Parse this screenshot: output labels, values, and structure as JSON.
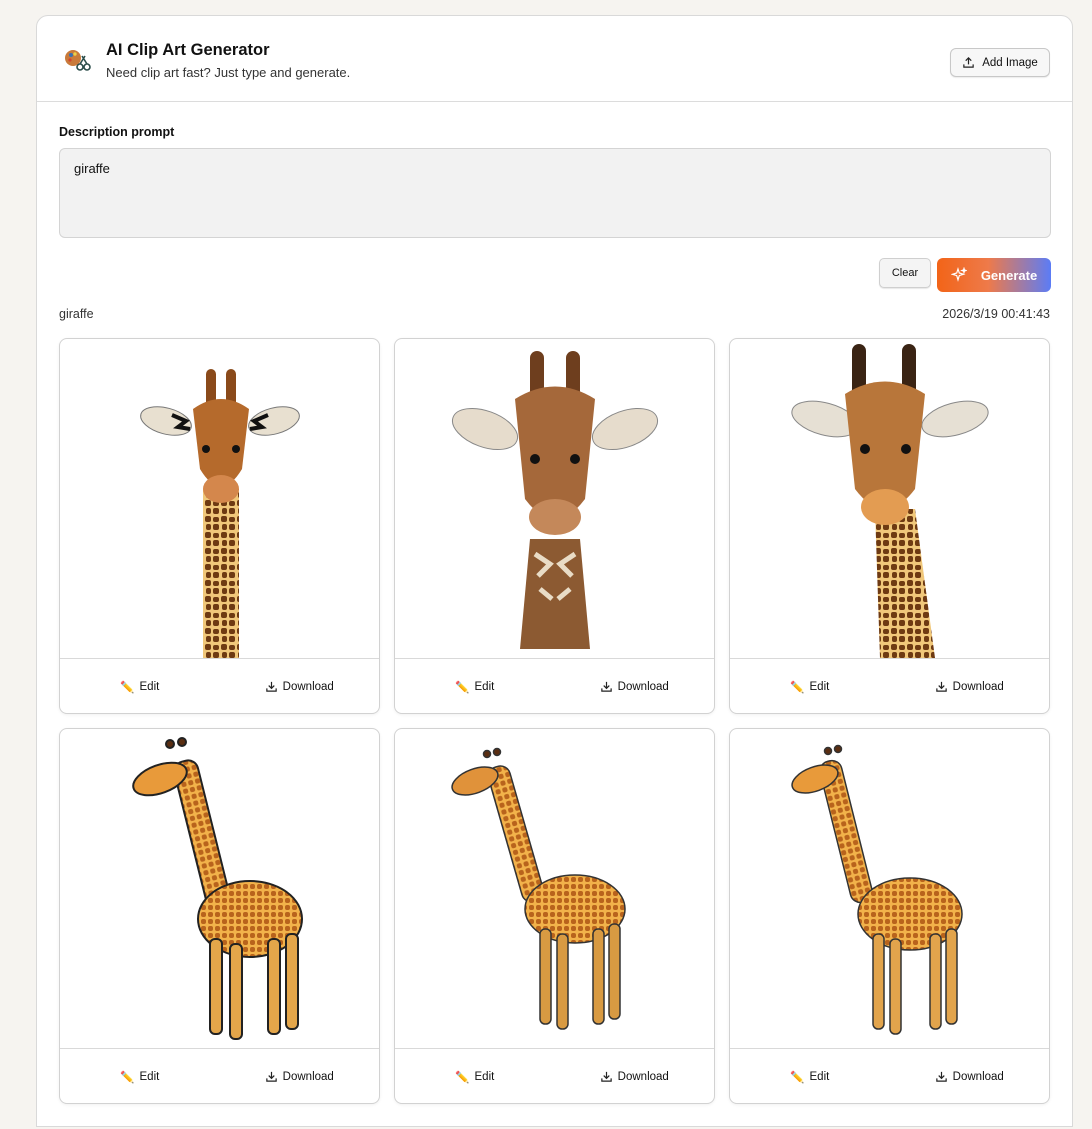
{
  "app": {
    "title": "AI Clip Art Generator",
    "subtitle": "Need clip art fast? Just type and generate.",
    "add_image_label": "Add Image"
  },
  "prompt": {
    "label": "Description prompt",
    "value": "giraffe"
  },
  "actions": {
    "clear_label": "Clear",
    "generate_label": "Generate"
  },
  "result": {
    "prompt": "giraffe",
    "timestamp": "2026/3/19 00:41:43"
  },
  "cards": [
    {
      "style": "head-stylized",
      "edit_label": "Edit",
      "download_label": "Download"
    },
    {
      "style": "head-realistic",
      "edit_label": "Edit",
      "download_label": "Download"
    },
    {
      "style": "head-detailed",
      "edit_label": "Edit",
      "download_label": "Download"
    },
    {
      "style": "full-cartoon",
      "edit_label": "Edit",
      "download_label": "Download"
    },
    {
      "style": "full-cartoon",
      "edit_label": "Edit",
      "download_label": "Download"
    },
    {
      "style": "full-cartoon",
      "edit_label": "Edit",
      "download_label": "Download"
    }
  ],
  "colors": {
    "accent_orange": "#f26418",
    "accent_blue": "#5b7cf6",
    "giraffe_base": "#e0a041",
    "giraffe_spot": "#8a4a1a"
  }
}
